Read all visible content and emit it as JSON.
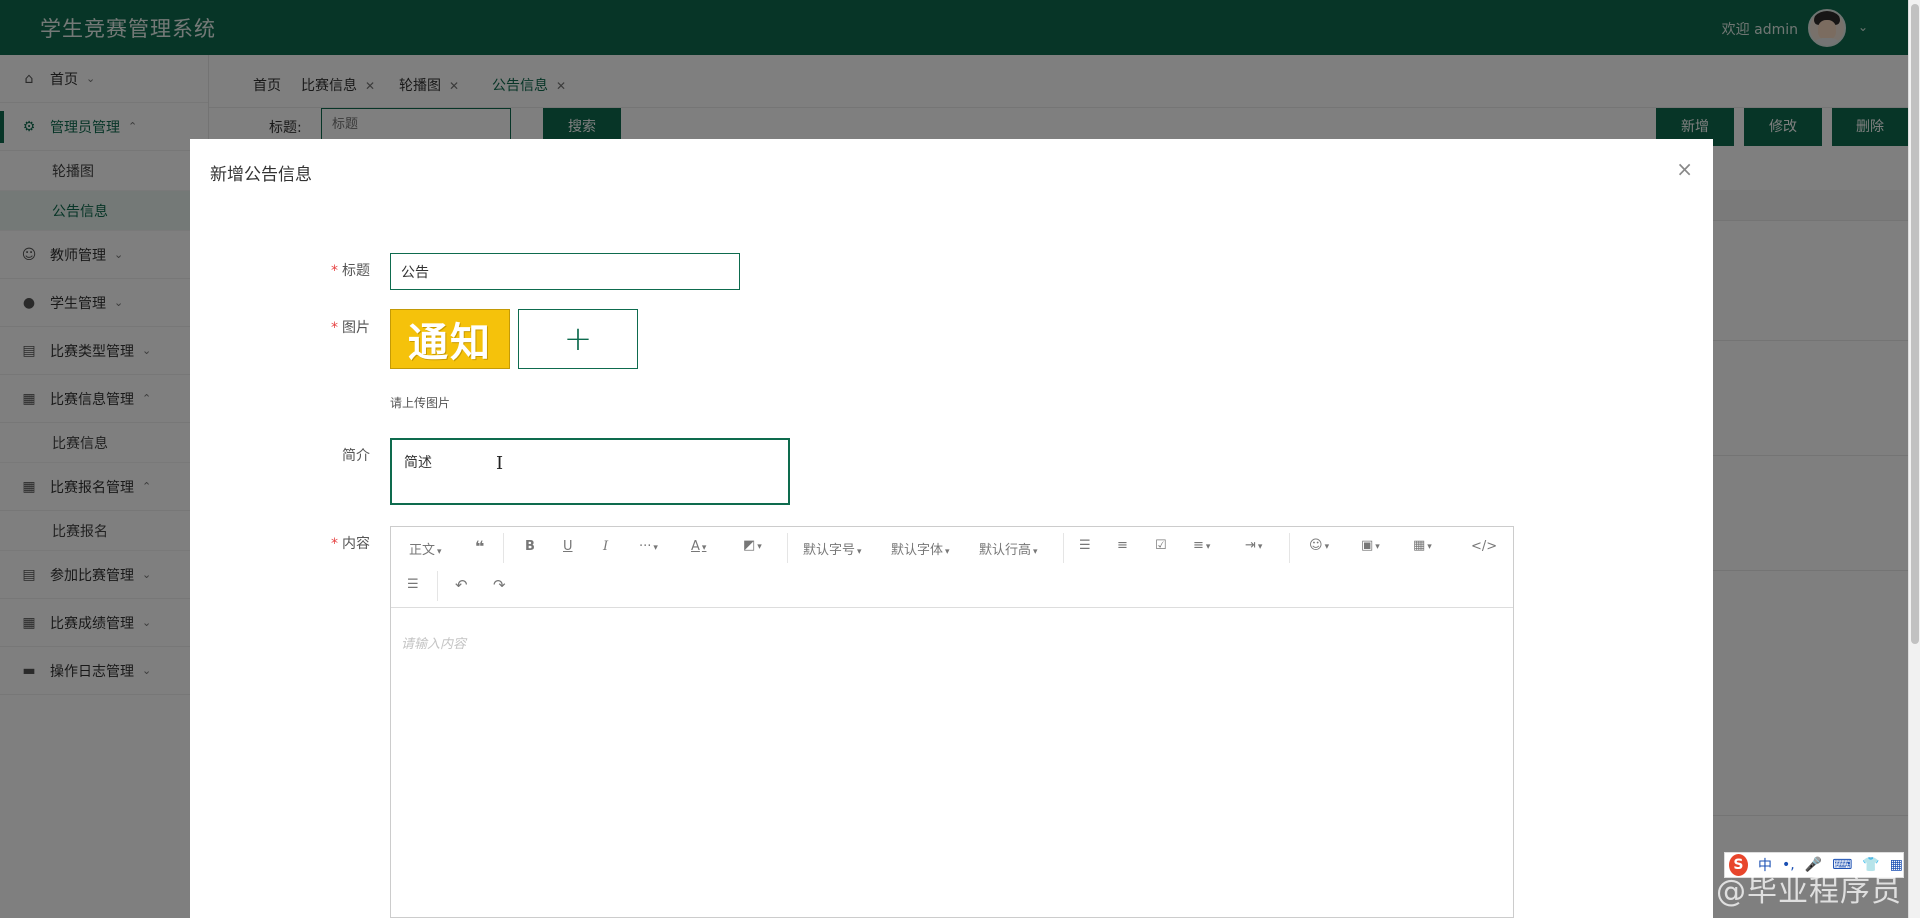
{
  "header": {
    "app_title": "学生竞赛管理系统",
    "welcome": "欢迎 admin"
  },
  "sidebar": {
    "items": [
      {
        "label": "首页",
        "icon": "home-icon"
      },
      {
        "label": "管理员管理",
        "icon": "admin-icon",
        "sub": [
          "轮播图",
          "公告信息"
        ]
      },
      {
        "label": "教师管理",
        "icon": "user-icon"
      },
      {
        "label": "学生管理",
        "icon": "student-icon"
      },
      {
        "label": "比赛类型管理",
        "icon": "list-icon"
      },
      {
        "label": "比赛信息管理",
        "icon": "grid-icon",
        "sub": [
          "比赛信息"
        ]
      },
      {
        "label": "比赛报名管理",
        "icon": "grid-icon",
        "sub": [
          "比赛报名"
        ]
      },
      {
        "label": "参加比赛管理",
        "icon": "list-icon"
      },
      {
        "label": "比赛成绩管理",
        "icon": "grid-icon"
      },
      {
        "label": "操作日志管理",
        "icon": "log-icon"
      }
    ]
  },
  "tabs": [
    {
      "label": "首页"
    },
    {
      "label": "比赛信息"
    },
    {
      "label": "轮播图"
    },
    {
      "label": "公告信息"
    }
  ],
  "toolbar": {
    "title_label": "标题:",
    "title_placeholder": "标题",
    "search_label": "搜索",
    "add_label": "新增",
    "edit_label": "修改",
    "delete_label": "删除"
  },
  "modal": {
    "title": "新增公告信息",
    "fields": {
      "title_label": "标题",
      "title_value": "公告",
      "image_label": "图片",
      "image_text": "通知",
      "upload_tip": "请上传图片",
      "intro_label": "简介",
      "intro_value": "简述",
      "content_label": "内容",
      "content_placeholder": "请输入内容"
    },
    "editor_toolbar": {
      "paragraph": "正文",
      "font_size": "默认字号",
      "font_family": "默认字体",
      "line_height": "默认行高"
    }
  },
  "watermark": "CSDN @毕业程序员",
  "ime": {
    "lang": "中"
  },
  "colors": {
    "brand": "#0e6b4e",
    "required": "#e64242"
  }
}
